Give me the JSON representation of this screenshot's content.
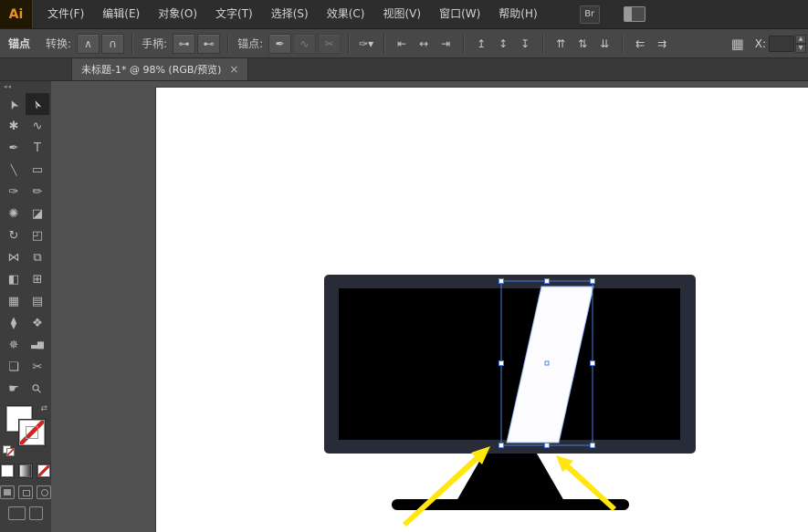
{
  "menu_bar": {
    "logo_text": "Ai",
    "items": [
      {
        "name": "menu-file",
        "label": "文件(F)"
      },
      {
        "name": "menu-edit",
        "label": "编辑(E)"
      },
      {
        "name": "menu-object",
        "label": "对象(O)"
      },
      {
        "name": "menu-type",
        "label": "文字(T)"
      },
      {
        "name": "menu-select",
        "label": "选择(S)"
      },
      {
        "name": "menu-effect",
        "label": "效果(C)"
      },
      {
        "name": "menu-view",
        "label": "视图(V)"
      },
      {
        "name": "menu-window",
        "label": "窗口(W)"
      },
      {
        "name": "menu-help",
        "label": "帮助(H)"
      }
    ],
    "bridge_label": "Br"
  },
  "control_bar": {
    "panel_title": "锚点",
    "groups": [
      {
        "type": "buttons",
        "label": "转换:",
        "icons": [
          {
            "name": "convert-to-corner-icon",
            "glyph": "∧"
          },
          {
            "name": "convert-to-smooth-icon",
            "glyph": "∩"
          }
        ]
      },
      {
        "type": "buttons",
        "label": "手柄:",
        "icons": [
          {
            "name": "show-handles-icon",
            "glyph": "⊶"
          },
          {
            "name": "hide-handles-icon",
            "glyph": "⊷"
          }
        ]
      },
      {
        "type": "buttons",
        "label": "锚点:",
        "icons": [
          {
            "name": "remove-anchor-icon",
            "glyph": "✒"
          },
          {
            "name": "connect-endpoints-icon",
            "glyph": "∿",
            "disabled": true
          },
          {
            "name": "cut-path-icon",
            "glyph": "✂",
            "disabled": true
          }
        ]
      },
      {
        "type": "flat",
        "icons": [
          {
            "name": "isolate-selection-icon",
            "glyph": "✑▾"
          }
        ]
      },
      {
        "type": "flat",
        "icons": [
          {
            "name": "align-left-icon",
            "glyph": "⇤"
          },
          {
            "name": "align-center-horizontal-icon",
            "glyph": "↔"
          },
          {
            "name": "align-right-icon",
            "glyph": "⇥"
          }
        ]
      },
      {
        "type": "flat",
        "icons": [
          {
            "name": "align-top-icon",
            "glyph": "↥"
          },
          {
            "name": "align-middle-vertical-icon",
            "glyph": "↕"
          },
          {
            "name": "align-bottom-icon",
            "glyph": "↧"
          }
        ]
      },
      {
        "type": "flat",
        "icons": [
          {
            "name": "distribute-top-icon",
            "glyph": "⇈"
          },
          {
            "name": "distribute-center-icon",
            "glyph": "⇅"
          },
          {
            "name": "distribute-bottom-icon",
            "glyph": "⇊"
          }
        ]
      },
      {
        "type": "flat",
        "icons": [
          {
            "name": "distribute-left-icon",
            "glyph": "⇇"
          },
          {
            "name": "distribute-right-icon",
            "glyph": "⇉"
          }
        ]
      }
    ],
    "grid_icon_glyph": "▦",
    "x_label": "X:",
    "x_value": "",
    "stepper_up_glyph": "▲",
    "stepper_down_glyph": "▼"
  },
  "tab": {
    "title": "未标题-1* @ 98% (RGB/预览)",
    "close_glyph": "×"
  },
  "toolbar": {
    "collapse_glyph": "◂◂",
    "swap_glyph": "⇄"
  },
  "tools": [
    {
      "name": "tool-selection",
      "glyph": "➤"
    },
    {
      "name": "tool-direct-selection",
      "glyph": "➢",
      "active": true
    },
    {
      "name": "tool-magic-wand",
      "glyph": "✱"
    },
    {
      "name": "tool-lasso",
      "glyph": "∿"
    },
    {
      "name": "tool-pen",
      "glyph": "✒"
    },
    {
      "name": "tool-type",
      "glyph": "T"
    },
    {
      "name": "tool-line-segment",
      "glyph": "╲"
    },
    {
      "name": "tool-rectangle",
      "glyph": "▭"
    },
    {
      "name": "tool-paintbrush",
      "glyph": "✑"
    },
    {
      "name": "tool-pencil",
      "glyph": "✏"
    },
    {
      "name": "tool-blob-brush",
      "glyph": "✺"
    },
    {
      "name": "tool-eraser",
      "glyph": "◪"
    },
    {
      "name": "tool-rotate",
      "glyph": "↻"
    },
    {
      "name": "tool-scale",
      "glyph": "◰"
    },
    {
      "name": "tool-width",
      "glyph": "⋈"
    },
    {
      "name": "tool-free-transform",
      "glyph": "⧉"
    },
    {
      "name": "tool-shape-builder",
      "glyph": "◧"
    },
    {
      "name": "tool-perspective-grid",
      "glyph": "⊞"
    },
    {
      "name": "tool-mesh",
      "glyph": "▦"
    },
    {
      "name": "tool-gradient",
      "glyph": "▤"
    },
    {
      "name": "tool-eyedropper",
      "glyph": "⧫"
    },
    {
      "name": "tool-blend",
      "glyph": "❖"
    },
    {
      "name": "tool-symbol-sprayer",
      "glyph": "✵"
    },
    {
      "name": "tool-column-graph",
      "glyph": "▃▆"
    },
    {
      "name": "tool-artboard",
      "glyph": "❏"
    },
    {
      "name": "tool-slice",
      "glyph": "✂"
    },
    {
      "name": "tool-hand",
      "glyph": "☛"
    },
    {
      "name": "tool-zoom",
      "glyph": "⚲"
    }
  ],
  "artwork": {
    "frame_color": "#272c38",
    "screen_color": "#000000",
    "stripe_color": "#fdfdff",
    "stripe_stroke": "#9db9f7",
    "stand_color": "#000000",
    "selection_color": "#4a7de2",
    "handle_fill": "#ffffff",
    "arrow_color": "#ffe70e"
  }
}
